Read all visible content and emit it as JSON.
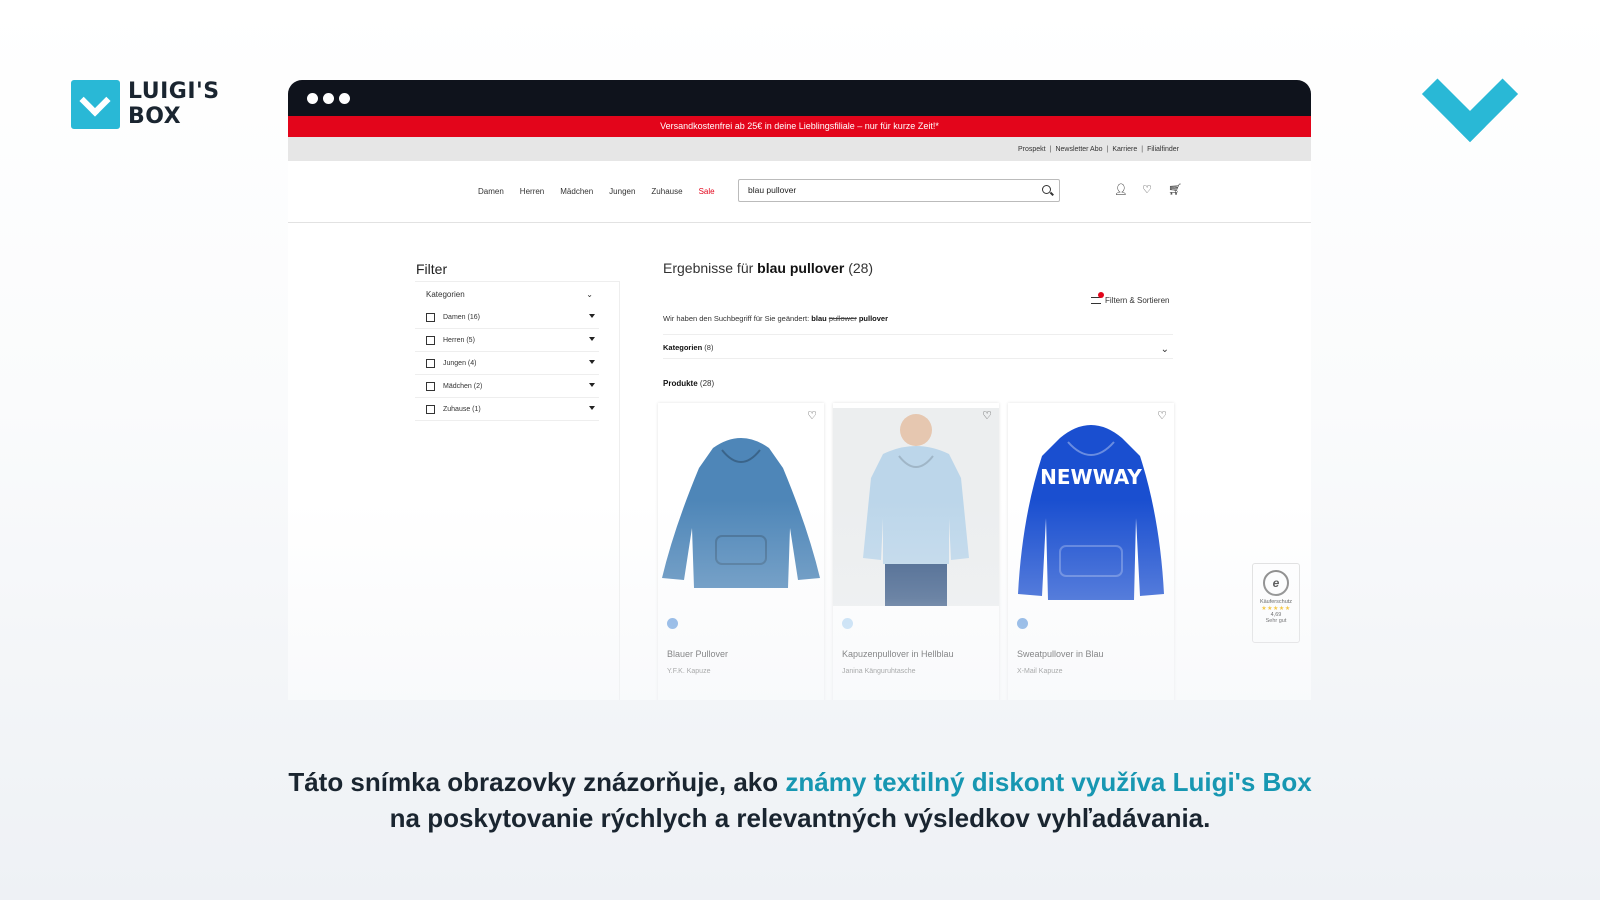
{
  "brand": {
    "logo_line1": "LUIGI'S",
    "logo_line2": "BOX",
    "accent": "#29b8d6"
  },
  "shop": {
    "promo": "Versandkostenfrei ab 25€ in deine Lieblingsfiliale – nur für kurze Zeit!*",
    "util_links": [
      "Prospekt",
      "Newsletter Abo",
      "Karriere",
      "Filialfinder"
    ],
    "nav": [
      "Damen",
      "Herren",
      "Mädchen",
      "Jungen",
      "Zuhause"
    ],
    "nav_sale": "Sale",
    "search_value": "blau pullover",
    "icons": [
      "user-icon",
      "heart-icon",
      "cart-icon"
    ],
    "promo_color": "#e3051b"
  },
  "filter": {
    "title": "Filter",
    "section": "Kategorien",
    "items": [
      "Damen (16)",
      "Herren (5)",
      "Jungen (4)",
      "Mädchen (2)",
      "Zuhause (1)"
    ]
  },
  "results": {
    "prefix": "Ergebnisse für",
    "query": "blau pullover",
    "count": "(28)",
    "sort_label": "Filtern & Sortieren",
    "changed_prefix": "Wir haben den Suchbegriff für Sie geändert:",
    "changed_from": "blau",
    "changed_strike": "pullower",
    "changed_to": "pullover",
    "cat_label": "Kategorien",
    "cat_count": "(8)",
    "products_label": "Produkte",
    "products_count": "(28)"
  },
  "products": [
    {
      "name": "Blauer Pullover",
      "sub": "Y.F.K. Kapuze",
      "color": "#4e86b8",
      "swatch": "#6fa3e0"
    },
    {
      "name": "Kapuzenpullover in Hellblau",
      "sub": "Janina Känguruhtasche",
      "color": "#bcd6ea",
      "swatch": "#bcdcf5"
    },
    {
      "name": "Sweatpullover in Blau",
      "sub": "X-Mail Kapuze",
      "color": "#1a4fd0",
      "swatch": "#6fa3e0"
    }
  ],
  "trust": {
    "seal_letter": "e",
    "label": "Käuferschutz",
    "stars": "★★★★★",
    "rating": "4,69",
    "verdict": "Sehr gut"
  },
  "caption": {
    "line1_before": "Táto snímka obrazovky znázorňuje, ako ",
    "line1_highlight": "známy textilný diskont využíva Luigi's Box",
    "line2": "na poskytovanie rýchlych a relevantných výsledkov vyhľadávania."
  }
}
